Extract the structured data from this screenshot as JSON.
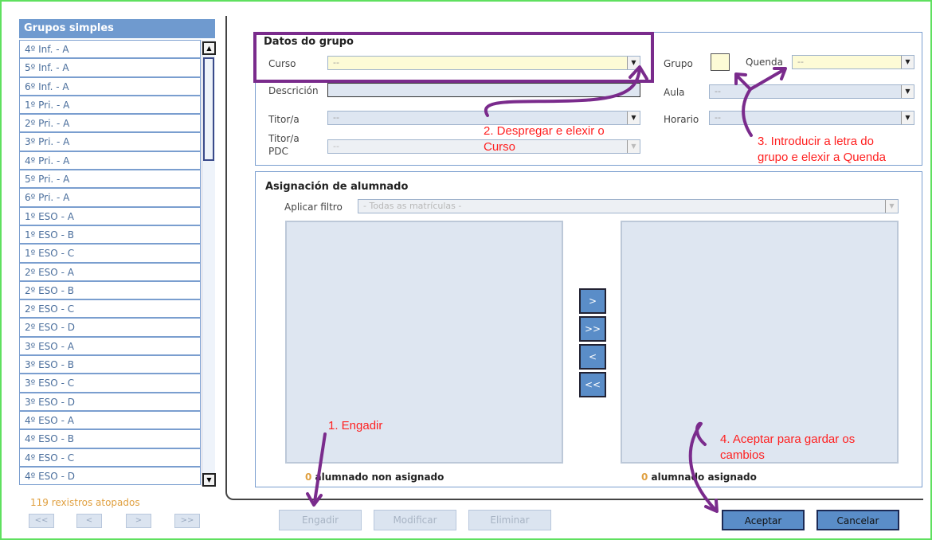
{
  "left_panel": {
    "header": "Grupos simples",
    "groups": [
      "4º Inf. - A",
      "5º Inf. - A",
      "6º Inf. - A",
      "1º Pri. - A",
      "2º Pri. - A",
      "3º Pri. - A",
      "4º Pri. - A",
      "5º Pri. - A",
      "6º Pri. - A",
      "1º ESO - A",
      "1º ESO - B",
      "1º ESO - C",
      "2º ESO - A",
      "2º ESO - B",
      "2º ESO - C",
      "2º ESO - D",
      "3º ESO - A",
      "3º ESO - B",
      "3º ESO - C",
      "3º ESO - D",
      "4º ESO - A",
      "4º ESO - B",
      "4º ESO - C",
      "4º ESO - D"
    ],
    "records": "119 rexistros atopados",
    "pager": {
      "first": "<<",
      "prev": "<",
      "next": ">",
      "last": ">>"
    },
    "scroll_up": "▲",
    "scroll_down": "▼"
  },
  "datos": {
    "title": "Datos do grupo",
    "curso_label": "Curso",
    "curso_value": "--",
    "descricion_label": "Descrición",
    "titor_label": "Titor/a",
    "titor_value": "--",
    "titor_pdc_label_1": "Titor/a",
    "titor_pdc_label_2": "PDC",
    "titor_pdc_value": "--",
    "grupo_label": "Grupo",
    "quenda_label": "Quenda",
    "quenda_value": "--",
    "aula_label": "Aula",
    "aula_value": "--",
    "horario_label": "Horario",
    "horario_value": "--",
    "dropdown_arrow": "▼"
  },
  "asignacion": {
    "title": "Asignación de alumnado",
    "filtro_label": "Aplicar filtro",
    "filtro_value": "- Todas as matrículas -",
    "move_buttons": [
      ">",
      ">>",
      "<",
      "<<"
    ],
    "non_asignado_count": "0",
    "non_asignado_label": "alumnado non asignado",
    "asignado_count": "0",
    "asignado_label": "alumnado asignado"
  },
  "actions": {
    "engadir": "Engadir",
    "modificar": "Modificar",
    "eliminar": "Eliminar",
    "aceptar": "Aceptar",
    "cancelar": "Cancelar"
  },
  "annotations": {
    "note1": "1. Engadir",
    "note2_line1": "2. Despregar e elexir o",
    "note2_line2": "Curso",
    "note3_line1": "3. Introducir a letra do",
    "note3_line2": "grupo e elexir a Quenda",
    "note4_line1": "4. Aceptar para gardar os",
    "note4_line2": "cambios"
  },
  "colors": {
    "frame": "#5fe05f",
    "header_bg": "#6f9acf",
    "annotation_red": "#ff2020",
    "annotation_purple": "#7a2b8c",
    "count_orange": "#e0a040",
    "button_blue": "#5a8dc8"
  }
}
